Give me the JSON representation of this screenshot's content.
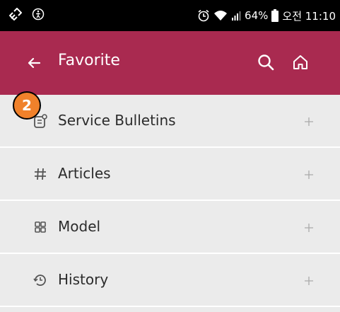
{
  "status_bar": {
    "battery": "64%",
    "time": "오전 11:10",
    "icons": [
      "link-icon",
      "accessibility-icon",
      "alarm-icon",
      "wifi-icon",
      "signal-icon",
      "battery-icon"
    ]
  },
  "header": {
    "title": "Favorite",
    "background_color": "#a92a50",
    "icons": [
      "back-arrow-icon",
      "search-icon",
      "home-icon"
    ]
  },
  "list": {
    "items": [
      {
        "label": "Service Bulletins",
        "icon": "bulletin-icon"
      },
      {
        "label": "Articles",
        "icon": "hash-icon"
      },
      {
        "label": "Model",
        "icon": "grid-icon"
      },
      {
        "label": "History",
        "icon": "history-icon"
      }
    ],
    "expand_icon": "plus-icon"
  },
  "annotation": {
    "badge": "2",
    "badge_color": "#f0812b"
  }
}
